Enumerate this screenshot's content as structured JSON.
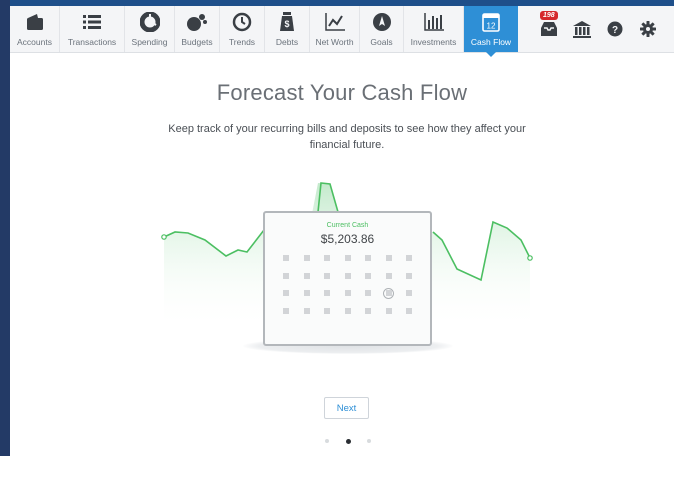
{
  "nav": {
    "items": [
      {
        "label": "Accounts",
        "icon": "wallet-icon",
        "active": false
      },
      {
        "label": "Transactions",
        "icon": "list-icon",
        "active": false
      },
      {
        "label": "Spending",
        "icon": "pie-chart-icon",
        "active": false
      },
      {
        "label": "Budgets",
        "icon": "coins-icon",
        "active": false
      },
      {
        "label": "Trends",
        "icon": "clock-icon",
        "active": false
      },
      {
        "label": "Debts",
        "icon": "money-bag-icon",
        "active": false
      },
      {
        "label": "Net Worth",
        "icon": "line-chart-icon",
        "active": false
      },
      {
        "label": "Goals",
        "icon": "compass-icon",
        "active": false
      },
      {
        "label": "Investments",
        "icon": "bar-chart-icon",
        "active": false
      },
      {
        "label": "Cash Flow",
        "icon": "calendar-icon",
        "active": true
      }
    ],
    "calendar_day": "12",
    "notifications_count": "198",
    "active_color": "#2e8fd6"
  },
  "content": {
    "title": "Forecast Your Cash Flow",
    "subtitle": "Keep track of your recurring bills and deposits to see how they affect your financial future."
  },
  "card": {
    "label": "Current Cash",
    "value": "$5,203.86"
  },
  "next_label": "Next",
  "pager": {
    "count": 3,
    "active_index": 1
  },
  "colors": {
    "accent": "#2e8fd6",
    "chart_green": "#4cbf62",
    "frame": "#233a66"
  }
}
